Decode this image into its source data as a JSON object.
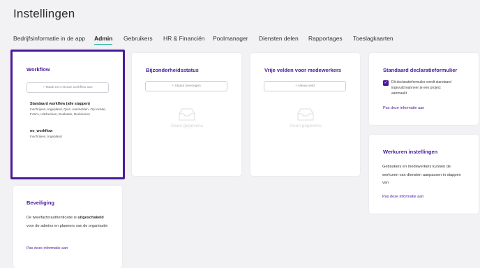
{
  "page": {
    "title": "Instellingen"
  },
  "tabs": [
    {
      "label": "Bedrijfsinformatie in de app"
    },
    {
      "label": "Admin"
    },
    {
      "label": "Gebruikers"
    },
    {
      "label": "HR & Financiën"
    },
    {
      "label": "Poolmanager"
    },
    {
      "label": "Diensten delen"
    },
    {
      "label": "Rapportages"
    },
    {
      "label": "Toeslagkaarten"
    }
  ],
  "workflow": {
    "title": "Workflow",
    "add_button": "+ Maak een nieuwe workflow aan",
    "items": [
      {
        "name": "Standaard workflow (alle stappen)",
        "steps": "Inschrijven, Ingepland, Quiz, Aanmelden, Op locatie, Foto's, Uitchecken, Evaluatie, Declareren"
      },
      {
        "name": "no_workflow",
        "steps": "Inschrijven, Ingepland"
      }
    ]
  },
  "bijzonderheid": {
    "title": "Bijzonderheidsstatus",
    "add_button": "+ Status toevoegen",
    "empty_text": "Geen gegevens"
  },
  "vrije_velden": {
    "title": "Vrije velden voor medewerkers",
    "add_button": "+ Nieuw veld",
    "empty_text": "Geen gegevens"
  },
  "declaratie": {
    "title": "Standaard declaratieformulier",
    "checkbox_checked": true,
    "checkbox_label": "Dit declaratieformulier wordt standaard ingevuld wanneer je een project aanmaakt",
    "link": "Pas deze informatie aan"
  },
  "werkuren": {
    "title": "Werkuren instellingen",
    "text": "Gebruikers en medewerkers kunnen de werkuren van diensten aanpassen in stappen van",
    "link": "Pas deze informatie aan"
  },
  "beveiliging": {
    "title": "Beveiliging",
    "text_before": "De tweefactorauthenticatie is ",
    "text_bold": "uitgeschakeld",
    "text_after": " voor de admins en planners van de organisatie",
    "link": "Pas deze informatie aan"
  },
  "colors": {
    "accent": "#4a1a9a",
    "tab_underline": "#20b39a"
  }
}
